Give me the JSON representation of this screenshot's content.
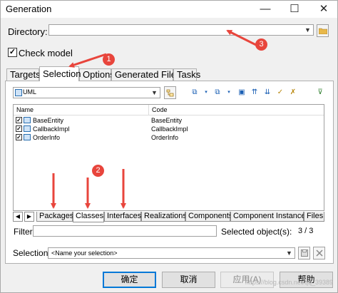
{
  "window": {
    "title": "Generation",
    "minimize_glyph": "—",
    "maximize_glyph": "☐",
    "close_glyph": "✕"
  },
  "directory": {
    "label": "Directory:",
    "value": ""
  },
  "check_model": {
    "label": "Check model",
    "checked": true
  },
  "tabs": [
    {
      "label": "Targets",
      "active": false
    },
    {
      "label": "Selection",
      "active": true
    },
    {
      "label": "Options",
      "active": false
    },
    {
      "label": "Generated Files",
      "active": false
    },
    {
      "label": "Tasks",
      "active": false
    }
  ],
  "selection": {
    "model_combo": "UML",
    "table": {
      "columns": [
        "Name",
        "Code"
      ],
      "rows": [
        {
          "name": "BaseEntity",
          "code": "BaseEntity",
          "checked": true
        },
        {
          "name": "CallbackImpl",
          "code": "CallbackImpl",
          "checked": true
        },
        {
          "name": "OrderInfo",
          "code": "OrderInfo",
          "checked": true
        }
      ]
    },
    "bottom_tabs": [
      {
        "label": "Packages",
        "active": false
      },
      {
        "label": "Classes",
        "active": true
      },
      {
        "label": "Interfaces",
        "active": false
      },
      {
        "label": "Realizations",
        "active": false
      },
      {
        "label": "Components",
        "active": false
      },
      {
        "label": "Component Instances",
        "active": false
      },
      {
        "label": "Files",
        "active": false
      }
    ],
    "nav_left": "◀",
    "nav_right": "▶"
  },
  "filter": {
    "label": "Filter:",
    "value": ""
  },
  "selected_objects": {
    "label": "Selected object(s):",
    "value": "3 / 3"
  },
  "selection_field": {
    "label": "Selection:",
    "value": "<Name your selection>"
  },
  "buttons": {
    "ok": "确定",
    "cancel": "取消",
    "apply": "应用(A)",
    "help": "帮助"
  },
  "annotations": [
    "1",
    "2",
    "3"
  ],
  "watermark": "https://blog.csdn.net/qq_39389",
  "colors": {
    "annotation": "#e8453c",
    "primary_border": "#0078d7"
  }
}
